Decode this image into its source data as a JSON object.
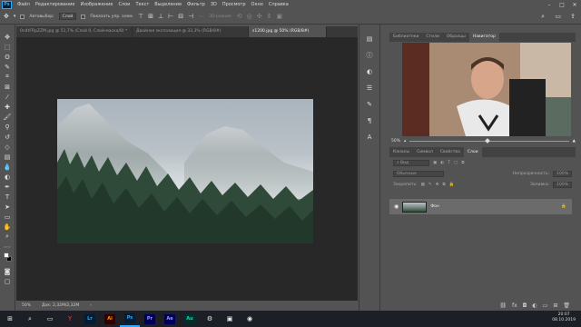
{
  "menu": {
    "logo": "Ps",
    "items": [
      "Файл",
      "Редактирование",
      "Изображение",
      "Слои",
      "Текст",
      "Выделение",
      "Фильтр",
      "3D",
      "Просмотр",
      "Окно",
      "Справка"
    ]
  },
  "options": {
    "autoselect_label": "Автовыбор:",
    "autoselect_value": "Слой",
    "show_controls_label": "Показать упр. элем.",
    "mode_3d": "3D-режим:"
  },
  "doc_tabs": [
    "0n4tFRpZZM.jpg @ 51,7% (Слой 0, Слой-маска/8) *",
    "Двойная экспозиция @ 33,3% (RGB/8#)",
    "s1200.jpg @ 50% (RGB/8#)"
  ],
  "status": {
    "zoom": "50%",
    "doc": "Док: 2,32M/2,32M"
  },
  "navigator": {
    "tabs": [
      "Библиотеки",
      "Стили",
      "Образцы",
      "Навигатор"
    ],
    "zoom": "50%"
  },
  "layers": {
    "tabs": [
      "Каналы",
      "Символ",
      "Свойства",
      "Слои"
    ],
    "kind_placeholder": "Вид",
    "blend_mode": "Обычные",
    "opacity_label": "Непрозрачность:",
    "opacity_value": "100%",
    "lock_label": "Закрепить:",
    "fill_label": "Заливка:",
    "fill_value": "100%",
    "layer_name": "Фон"
  },
  "clock": {
    "time": "20:07",
    "date": "08.10.2019"
  },
  "taskbar_apps": [
    "Lr",
    "Ai",
    "Ps",
    "Pr",
    "Ae",
    "Au"
  ],
  "colors": {
    "ps": "#31a8ff",
    "ai": "#ff9a00",
    "pr": "#9999ff",
    "ae": "#9999ff",
    "au": "#00e4bb",
    "lr": "#31a8ff"
  }
}
